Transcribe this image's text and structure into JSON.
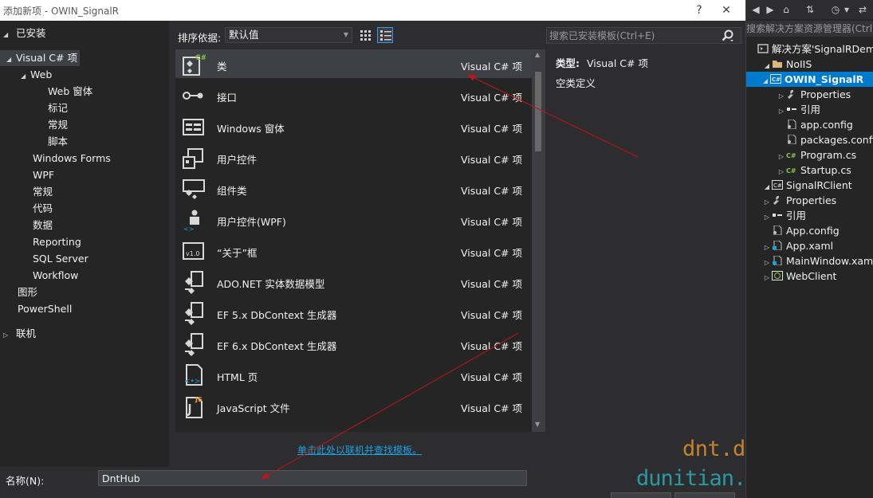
{
  "titlebar": {
    "title": "添加新项 - OWIN_SignalR",
    "help": "?",
    "close": "✕"
  },
  "left_tree": {
    "installed": "已安装",
    "items": [
      {
        "label": "Visual C# 项",
        "level": 1,
        "expanded": true,
        "selected": true
      },
      {
        "label": "Web",
        "level": 2,
        "expanded": true
      },
      {
        "label": "Web 窗体",
        "level": 3
      },
      {
        "label": "标记",
        "level": 3
      },
      {
        "label": "常规",
        "level": 3
      },
      {
        "label": "脚本",
        "level": 3
      },
      {
        "label": "Windows Forms",
        "level": 2
      },
      {
        "label": "WPF",
        "level": 2
      },
      {
        "label": "常规",
        "level": 2
      },
      {
        "label": "代码",
        "level": 2
      },
      {
        "label": "数据",
        "level": 2
      },
      {
        "label": "Reporting",
        "level": 2
      },
      {
        "label": "SQL Server",
        "level": 2
      },
      {
        "label": "Workflow",
        "level": 2
      },
      {
        "label": "图形",
        "level": 1
      },
      {
        "label": "PowerShell",
        "level": 1
      }
    ],
    "online": "联机"
  },
  "toolbar": {
    "sort_label": "排序依据:",
    "sort_value": "默认值",
    "search_placeholder": "搜索已安装模板(Ctrl+E)"
  },
  "templates": [
    {
      "name": "类",
      "type": "Visual C# 项",
      "icon": "class-icon",
      "selected": true
    },
    {
      "name": "接口",
      "type": "Visual C# 项",
      "icon": "interface-icon"
    },
    {
      "name": "Windows 窗体",
      "type": "Visual C# 项",
      "icon": "windows-form-icon"
    },
    {
      "name": "用户控件",
      "type": "Visual C# 项",
      "icon": "user-control-icon"
    },
    {
      "name": "组件类",
      "type": "Visual C# 项",
      "icon": "component-class-icon"
    },
    {
      "name": "用户控件(WPF)",
      "type": "Visual C# 项",
      "icon": "wpf-user-control-icon"
    },
    {
      "name": "“关于”框",
      "type": "Visual C# 项",
      "icon": "about-box-icon"
    },
    {
      "name": "ADO.NET 实体数据模型",
      "type": "Visual C# 项",
      "icon": "entity-model-icon"
    },
    {
      "name": "EF 5.x DbContext 生成器",
      "type": "Visual C# 项",
      "icon": "dbcontext-generator-icon"
    },
    {
      "name": "EF 6.x DbContext 生成器",
      "type": "Visual C# 项",
      "icon": "dbcontext-generator-icon"
    },
    {
      "name": "HTML 页",
      "type": "Visual C# 项",
      "icon": "html-page-icon"
    },
    {
      "name": "JavaScript 文件",
      "type": "Visual C# 项",
      "icon": "javascript-file-icon"
    }
  ],
  "details": {
    "type_label": "类型:",
    "type_value": "Visual C# 项",
    "description": "空类定义"
  },
  "online_link": "单击此处以联机并查找模板。",
  "name_field": {
    "label": "名称(N):",
    "value": "DntHub"
  },
  "watermark": {
    "line1": "dnt.dkill.net",
    "line2": "dunitian.cnblogs.com"
  },
  "solution_explorer": {
    "search_placeholder": "搜索解决方案资源管理器(Ctrl+",
    "nodes": [
      {
        "label": "解决方案'SignalRDemo'",
        "level": 0,
        "icon": "solution-icon"
      },
      {
        "label": "NoIIS",
        "level": 1,
        "icon": "folder-icon",
        "expanded": true
      },
      {
        "label": "OWIN_SignalR",
        "level": 2,
        "icon": "csharp-project-icon",
        "expanded": true,
        "selected": true
      },
      {
        "label": "Properties",
        "level": 3,
        "icon": "wrench-icon",
        "tri": true
      },
      {
        "label": "引用",
        "level": 3,
        "icon": "references-icon",
        "tri": true
      },
      {
        "label": "app.config",
        "level": 3,
        "icon": "config-file-icon"
      },
      {
        "label": "packages.config",
        "level": 3,
        "icon": "config-file-icon"
      },
      {
        "label": "Program.cs",
        "level": 3,
        "icon": "csharp-file-icon",
        "tri": true
      },
      {
        "label": "Startup.cs",
        "level": 3,
        "icon": "csharp-file-icon",
        "tri": true
      },
      {
        "label": "SignalRClient",
        "level": 1,
        "icon": "csharp-project-icon",
        "expanded": true
      },
      {
        "label": "Properties",
        "level": 2,
        "icon": "wrench-icon",
        "tri": true
      },
      {
        "label": "引用",
        "level": 2,
        "icon": "references-icon",
        "tri": true
      },
      {
        "label": "App.config",
        "level": 2,
        "icon": "config-file-icon"
      },
      {
        "label": "App.xaml",
        "level": 2,
        "icon": "xaml-file-icon",
        "tri": true
      },
      {
        "label": "MainWindow.xaml",
        "level": 2,
        "icon": "xaml-file-icon",
        "tri": true
      },
      {
        "label": "WebClient",
        "level": 1,
        "icon": "web-project-icon",
        "tri": true
      }
    ]
  },
  "colors": {
    "accent": "#007acc",
    "background": "#2d2d30",
    "panel": "#252526",
    "arrow": "#c0141b"
  }
}
